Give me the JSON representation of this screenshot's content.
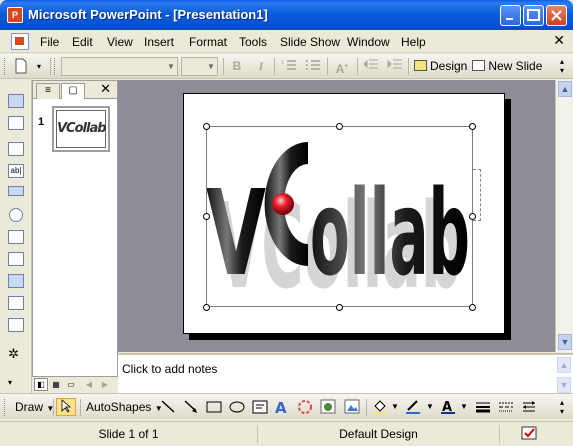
{
  "window": {
    "title": "Microsoft PowerPoint - [Presentation1]",
    "app_icon": "powerpoint-icon",
    "buttons": [
      "minimize",
      "maximize",
      "close"
    ]
  },
  "menu": {
    "items": [
      "File",
      "Edit",
      "View",
      "Insert",
      "Format",
      "Tools",
      "Slide Show",
      "Window",
      "Help"
    ],
    "close_glyph": "✕"
  },
  "toolbar": {
    "font_name": "",
    "font_size": "",
    "bold": "B",
    "italic": "I",
    "design_label": "Design",
    "new_slide_label": "New Slide"
  },
  "slides_pane": {
    "tab_outline": "outline-tab",
    "tab_slides": "slides-tab",
    "close_glyph": "✕",
    "slides": [
      {
        "number": "1",
        "thumb_text": "VCollab"
      }
    ]
  },
  "slide": {
    "logo_text_v": "V",
    "logo_text_rest": "ollab"
  },
  "notes": {
    "placeholder": "Click to add notes"
  },
  "drawing_toolbar": {
    "draw_label": "Draw",
    "autoshapes_label": "AutoShapes"
  },
  "status": {
    "slide_info": "Slide 1 of 1",
    "design": "Default Design"
  },
  "colors": {
    "titlebar": "#0A5FE3",
    "chrome": "#ECE9D8",
    "workarea": "#8C8D97",
    "logo_accent": "#E8202B"
  }
}
